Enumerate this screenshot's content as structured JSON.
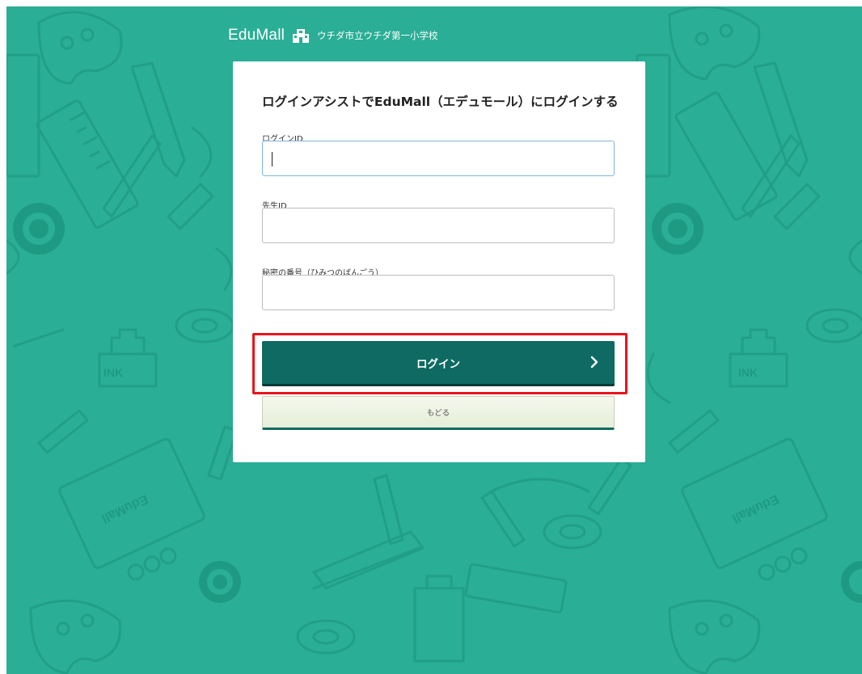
{
  "header": {
    "logo": "EduMall",
    "school_name": "ウチダ市立ウチダ第一小学校"
  },
  "form": {
    "title": "ログインアシストでEduMall（エデュモール）にログインする",
    "login_id_label": "ログインID",
    "login_id_value": "",
    "teacher_id_label": "先生ID",
    "teacher_id_value": "",
    "password_label": "秘密の番号（ひみつのばんごう）",
    "password_value": "",
    "login_button": "ログイン",
    "back_button": "もどる"
  },
  "background_decoration": {
    "ink_label": "INK",
    "brand_text": "EduMall"
  },
  "colors": {
    "background": "#2aae95",
    "primary_button": "#0e6a62",
    "highlight": "#e8141c"
  }
}
